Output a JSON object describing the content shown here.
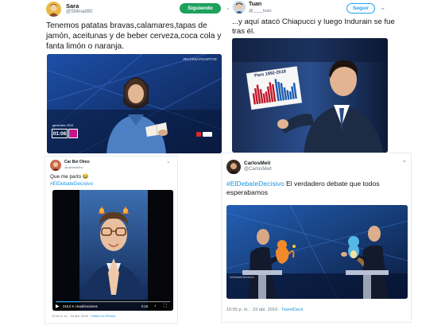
{
  "tweets": [
    {
      "name": "Sara",
      "handle": "@SMmad90",
      "follow_label": "Siguiendo",
      "text": "Tenemos patatas bravas,calamares,tapas de jamón, aceitunas y de beber cerveza,coca cola y fanta limón o naranja.",
      "media": {
        "banner": "#ELDEBATEenRTVE",
        "clock_label": "generales 2019",
        "clock": "01:06"
      }
    },
    {
      "name": "Tuan",
      "handle": "@____tuan",
      "follow_label": "Seguir",
      "text": "...y aquí atacó Chiapucci y luego Indurain se fue tras él.",
      "media": {
        "chart_title": "Paro 1992-2018"
      }
    },
    {
      "name": "Car Bel Olmo",
      "handle": "@carbelolmo",
      "text": "Que me parto",
      "emoji": "😂",
      "hashtag": "#ElDebateDecisivo",
      "media": {
        "views": "316,5 K visualizaciones",
        "time": "0:16"
      },
      "meta_time": "12:31 a. m. · 24 abr. 2019",
      "meta_source": "Twitter for iPhone"
    },
    {
      "name": "CarlosMeit",
      "handle": "@CarlosMeit",
      "hashtag": "#ElDebateDecisivo",
      "text": "El verdadero debate que todos esperabamos",
      "media": {
        "watermark": "/eldebatedecisivo"
      },
      "meta_time": "10:55 p. m. · 23 abr. 2019",
      "meta_source": "TweetDeck"
    }
  ],
  "colors": {
    "link": "#1b95e0",
    "follow_green": "#1da15d",
    "follow_blue": "#1da1f2",
    "studio_blue": "#1f3f8a",
    "studio_dark": "#0e1930"
  }
}
